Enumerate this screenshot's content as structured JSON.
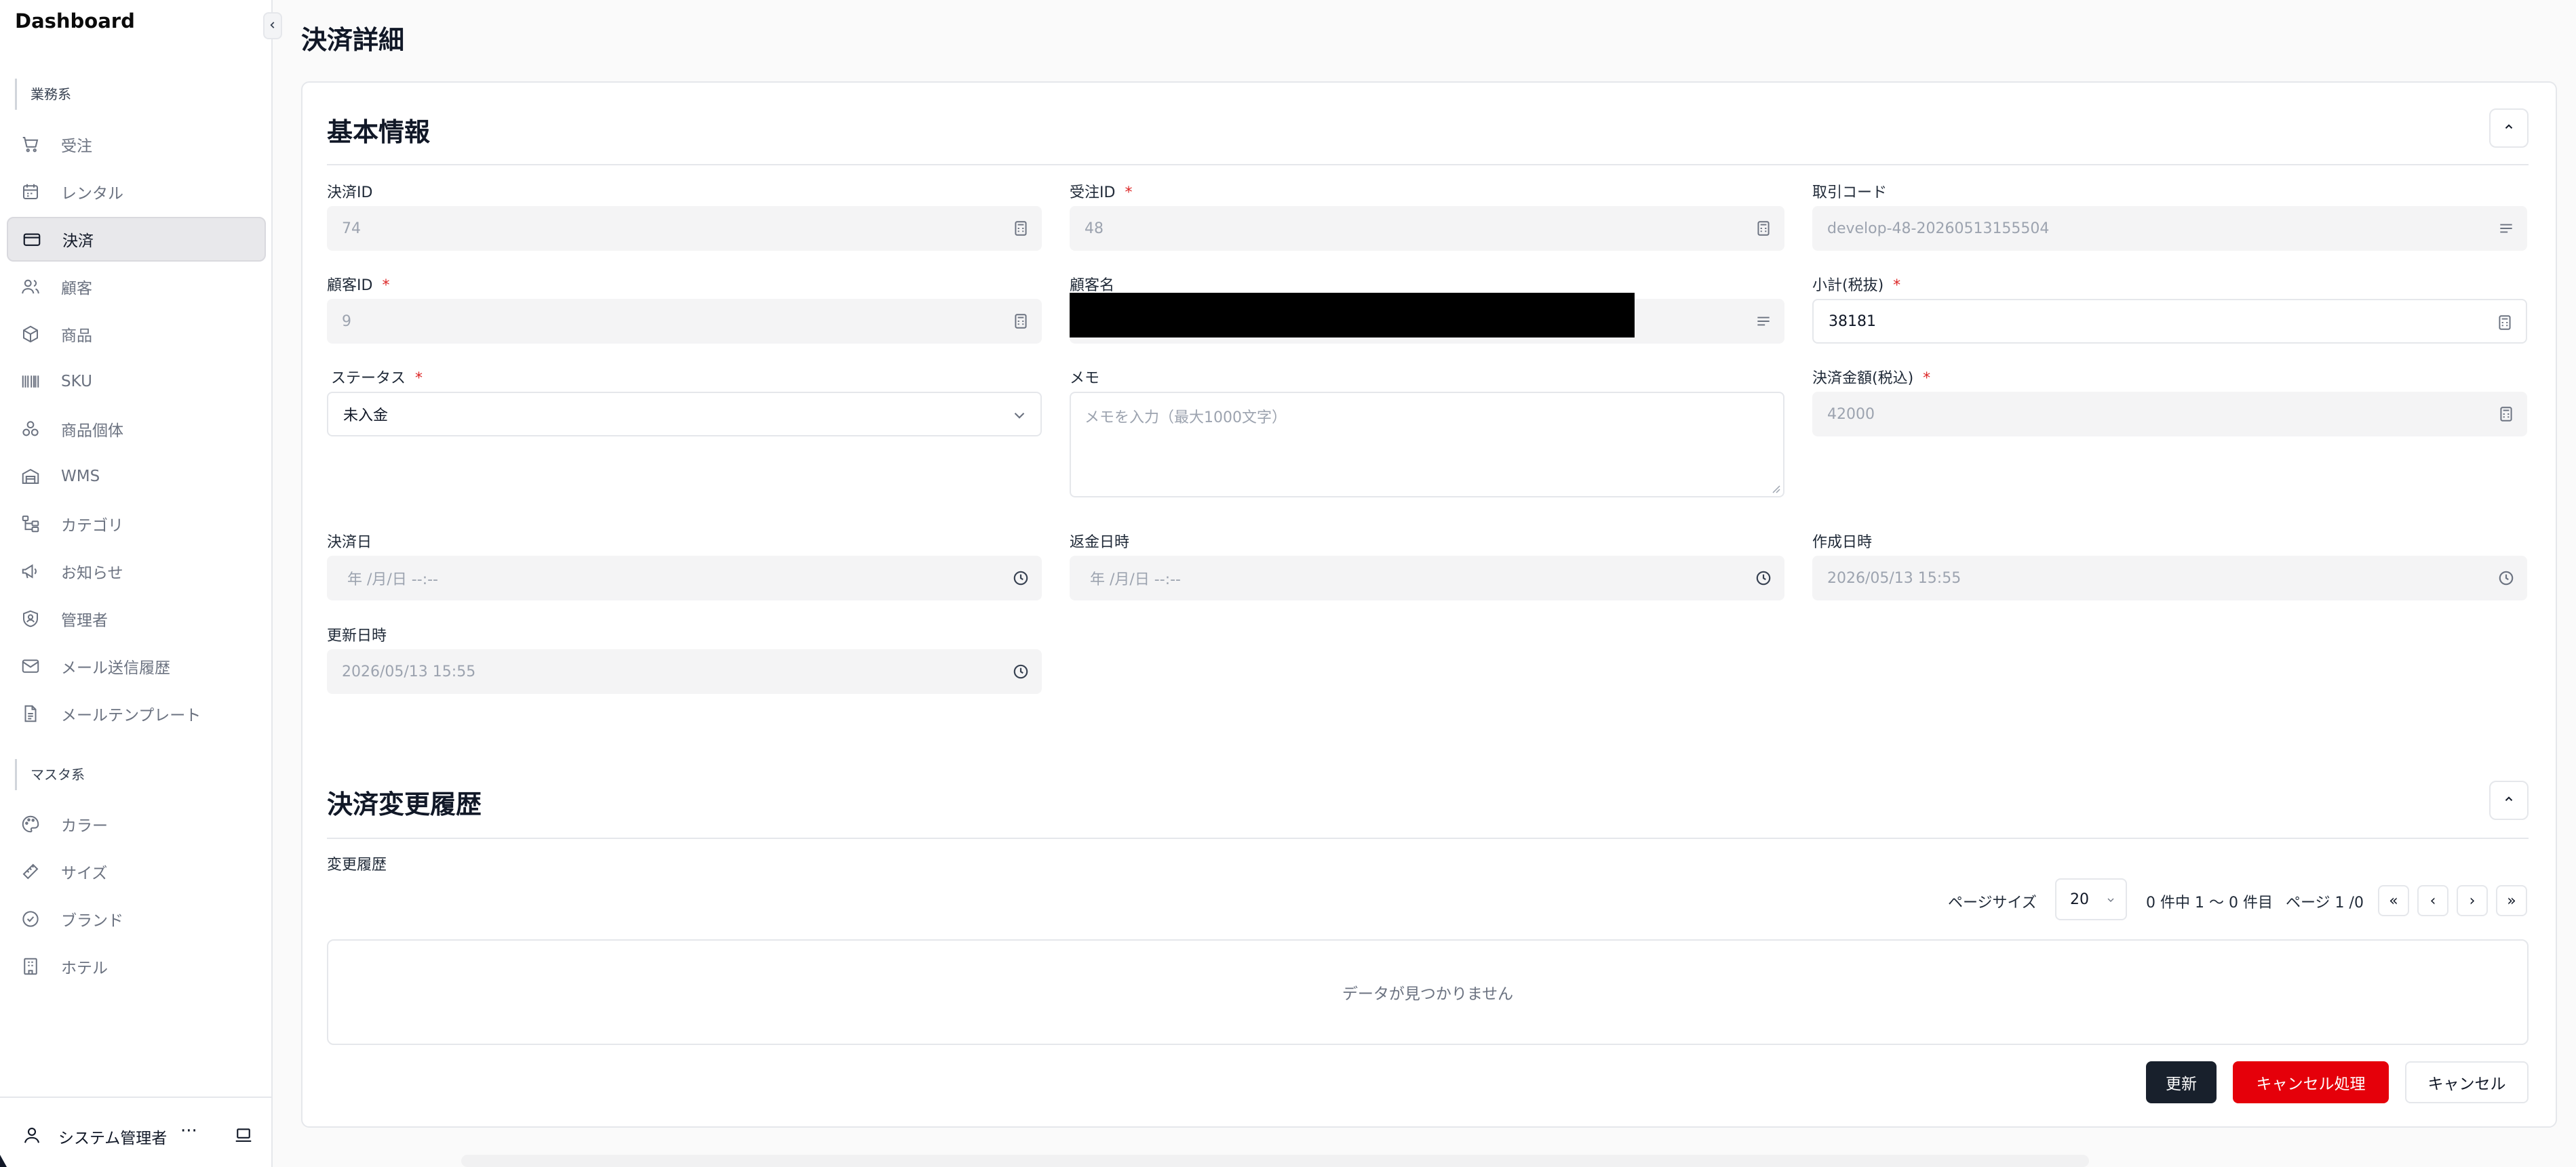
{
  "sidebar": {
    "brand": "Dashboard",
    "group1": "業務系",
    "items1": [
      {
        "label": "受注",
        "icon": "cart-icon"
      },
      {
        "label": "レンタル",
        "icon": "calendar-icon"
      },
      {
        "label": "決済",
        "icon": "credit-card-icon",
        "active": true
      },
      {
        "label": "顧客",
        "icon": "users-icon"
      },
      {
        "label": "商品",
        "icon": "package-icon"
      },
      {
        "label": "SKU",
        "icon": "barcode-icon"
      },
      {
        "label": "商品個体",
        "icon": "boxes-icon"
      },
      {
        "label": "WMS",
        "icon": "warehouse-icon"
      },
      {
        "label": "カテゴリ",
        "icon": "category-tree-icon"
      },
      {
        "label": "お知らせ",
        "icon": "megaphone-icon"
      },
      {
        "label": "管理者",
        "icon": "shield-user-icon"
      },
      {
        "label": "メール送信履歴",
        "icon": "mail-icon"
      },
      {
        "label": "メールテンプレート",
        "icon": "file-text-icon"
      }
    ],
    "group2": "マスタ系",
    "items2": [
      {
        "label": "カラー",
        "icon": "palette-icon"
      },
      {
        "label": "サイズ",
        "icon": "ruler-icon"
      },
      {
        "label": "ブランド",
        "icon": "badge-check-icon"
      },
      {
        "label": "ホテル",
        "icon": "hotel-icon"
      }
    ],
    "user": "システム管理者",
    "more": "···"
  },
  "page": {
    "title": "決済詳細",
    "section1_title": "基本情報",
    "section2_title": "決済変更履歴"
  },
  "fields": {
    "payment_id": {
      "label": "決済ID",
      "value": "74"
    },
    "order_id": {
      "label": "受注ID",
      "required": "*",
      "value": "48"
    },
    "transaction_code": {
      "label": "取引コード",
      "value": "develop-48-20260513155504"
    },
    "customer_id": {
      "label": "顧客ID",
      "required": "*",
      "value": "9"
    },
    "customer_name": {
      "label": "顧客名",
      "value": ""
    },
    "subtotal": {
      "label": "小計(税抜)",
      "required": "*",
      "value": "38181"
    },
    "status": {
      "label": "ステータス",
      "required": "*",
      "value": "未入金"
    },
    "memo": {
      "label": "メモ",
      "placeholder": "メモを入力（最大1000文字）"
    },
    "amount": {
      "label": "決済金額(税込)",
      "required": "*",
      "value": "42000"
    },
    "payment_date": {
      "label": "決済日",
      "value": "年 /月/日 --:--"
    },
    "refund_date": {
      "label": "返金日時",
      "value": "年 /月/日 --:--"
    },
    "created_at": {
      "label": "作成日時",
      "value": "2026/05/13 15:55"
    },
    "updated_at": {
      "label": "更新日時",
      "value": "2026/05/13 15:55"
    }
  },
  "history": {
    "label": "変更履歴",
    "page_size_label": "ページサイズ",
    "page_size": "20",
    "range_text": "0 件中 1 〜 0 件目",
    "page_text": "ページ 1 /0",
    "first": "«",
    "prev": "‹",
    "next": "›",
    "last": "»",
    "empty": "データが見つかりません"
  },
  "actions": {
    "update": "更新",
    "cancel_process": "キャンセル処理",
    "cancel": "キャンセル"
  },
  "colors": {
    "accent_dark": "#18202c",
    "danger": "#e5000a",
    "required": "#dc2626"
  }
}
